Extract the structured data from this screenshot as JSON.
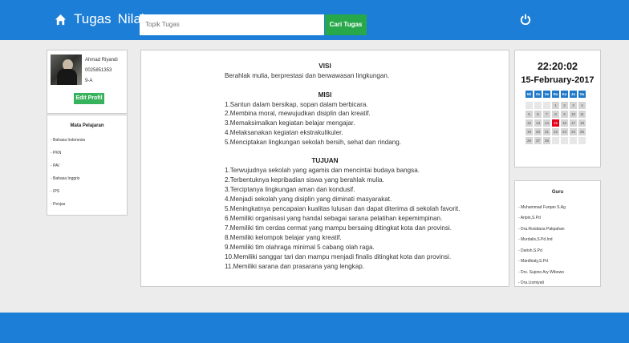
{
  "nav": {
    "home_icon": "home-icon",
    "links": [
      "Tugas",
      "Nilai"
    ],
    "search_placeholder": "Topik Tugas",
    "search_button": "Cari Tugas",
    "power_icon": "power-icon",
    "accent": "#1c7ed6"
  },
  "profile": {
    "name": "Ahmad Riyandi",
    "id": "0025851353",
    "class": "9-A",
    "edit_button": "Edit Profil"
  },
  "subjects": {
    "title": "Mata Pelajaran",
    "items": [
      "- Bahasa Indonesia",
      "- PKN",
      "- PAI",
      "- Bahasa Inggris",
      "- IPS",
      "- Penjas"
    ]
  },
  "content": {
    "visi_title": "VISI",
    "visi": "Berahlak mulia, berprestasi dan berwawasan lingkungan.",
    "misi_title": "MISI",
    "misi": [
      "1.Santun dalam bersikap, sopan dalam berbicara.",
      "2.Membina moral, mewujudkan disiplin dan kreatif.",
      "3.Memaksimalkan kegiatan belajar mengajar.",
      "4.Melaksanakan kegiatan ekstrakulikuler.",
      "5.Menciptakan lingkungan sekolah bersih, sehat dan rindang."
    ],
    "tujuan_title": "TUJUAN",
    "tujuan": [
      "1.Terwujudnya sekolah yang agamis dan mencintai budaya bangsa.",
      "2.Terbentuknya kepribadian siswa yang berahlak mulia.",
      "3.Terciptanya lingkungan aman dan kondusif.",
      "4.Menjadi sekolah yang disiplin yang diminati masyarakat.",
      "5.Meningkatnya pencapaian kualitas lulusan dan dapat diterima di sekolah favorit.",
      "6.Memiliki organisasi yang handal sebagai sarana pelatihan kepemimpinan.",
      "7.Memiliki tim cerdas cermat yang mampu bersaing ditingkat kota dan provinsi.",
      "8.Memiliki kelompok belajar yang kreatif.",
      "9.Memiliki tim olahraga minimal 5 cabang olah raga.",
      "10.Memiliki sanggar tari dan mampu menjadi finalis ditingkat kota dan provinsi.",
      "11.Memiliki sarana dan prasarana yang lengkap."
    ]
  },
  "clock": {
    "time": "22:20:02",
    "date": "15-February-2017"
  },
  "calendar": {
    "days": [
      "Mi",
      "Se",
      "Se",
      "Ra",
      "Ka",
      "Ju",
      "Sa"
    ],
    "rows": [
      [
        "",
        "",
        "",
        "1",
        "2",
        "3",
        "4"
      ],
      [
        "5",
        "6",
        "7",
        "8",
        "9",
        "10",
        "11"
      ],
      [
        "12",
        "13",
        "14",
        "15",
        "16",
        "17",
        "18"
      ],
      [
        "19",
        "20",
        "21",
        "22",
        "23",
        "24",
        "25"
      ],
      [
        "26",
        "27",
        "28",
        "",
        "",
        "",
        ""
      ]
    ],
    "today": "15",
    "today_color": "#e60018"
  },
  "teachers": {
    "title": "Guru",
    "items": [
      "- Muhammad Furqan S.Ag",
      "- Aripin,S.Pd",
      "- Dra.Rosidana Pakpahan",
      "- Murdalis,S.Pd.Ind",
      "- Darish,S.Pd",
      "- Mardhiaty,S.Pd",
      "- Drs. Sujono Ary Wibowo",
      "- Dra.Lismiyati"
    ]
  }
}
